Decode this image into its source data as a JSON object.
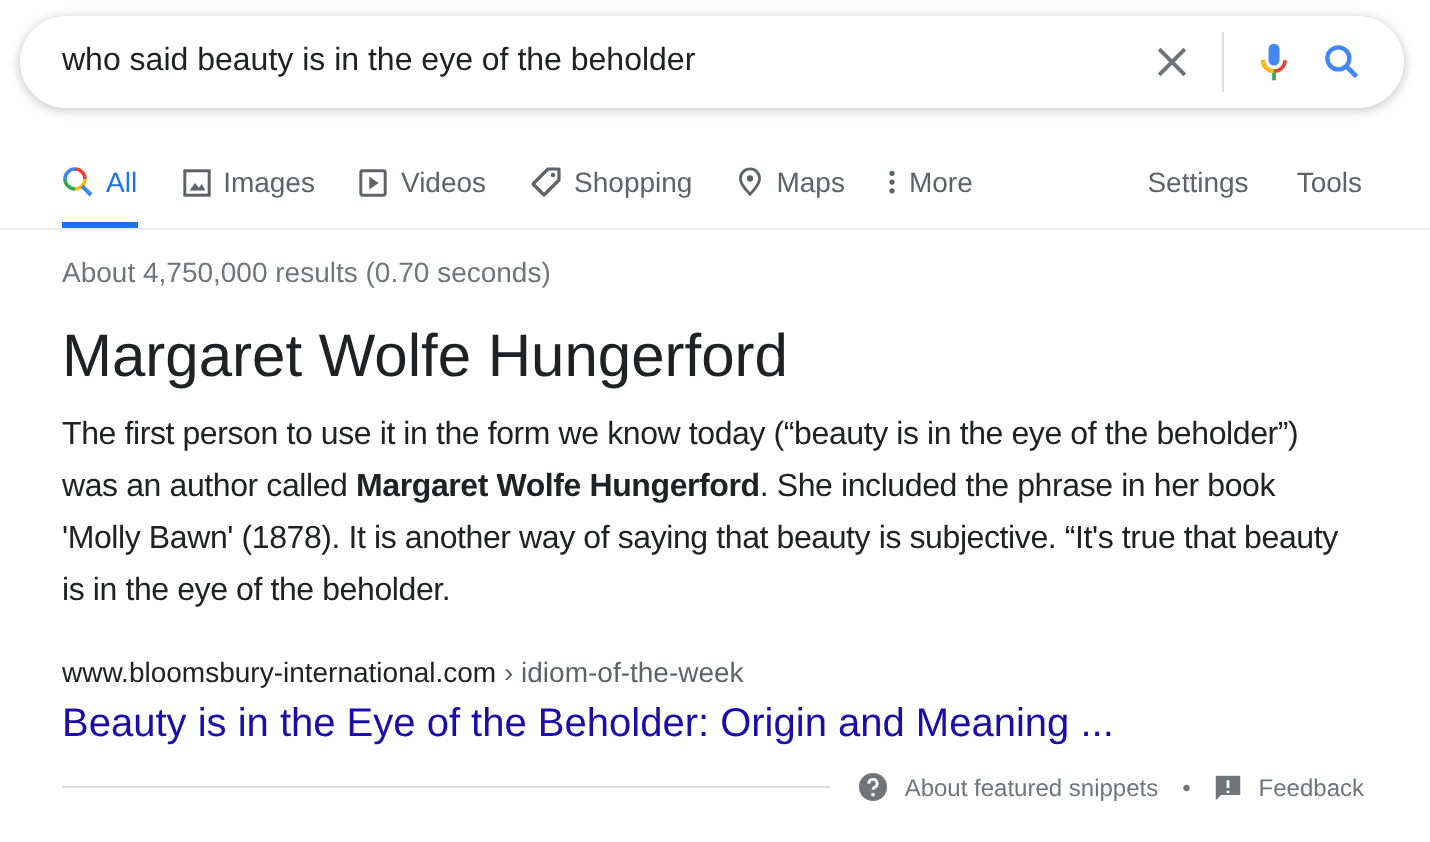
{
  "search": {
    "value": "who said beauty is in the eye of the beholder"
  },
  "tabs": [
    {
      "label": "All",
      "kind": "all",
      "selected": true
    },
    {
      "label": "Images",
      "kind": "images",
      "selected": false
    },
    {
      "label": "Videos",
      "kind": "videos",
      "selected": false
    },
    {
      "label": "Shopping",
      "kind": "shopping",
      "selected": false
    },
    {
      "label": "Maps",
      "kind": "maps",
      "selected": false
    },
    {
      "label": "More",
      "kind": "more",
      "selected": false
    }
  ],
  "tools": [
    "Settings",
    "Tools"
  ],
  "result_stats": "About 4,750,000 results (0.70 seconds)",
  "snippet": {
    "title": "Margaret Wolfe Hungerford",
    "text": "The first person to use it in the form we know today (“beauty is in the eye of the beholder”) was an author called **Margaret Wolfe Hungerford**. She included the phrase in her book 'Molly Bawn' (1878). It is another way of saying that beauty is subjective. “It's true that beauty is in the eye of the beholder.",
    "source_domain": "www.bloomsbury-international.com",
    "source_path": "› idiom-of-the-week",
    "link": "Beauty is in the Eye of the Beholder: Origin and Meaning ...",
    "footer": {
      "about": "About featured snippets",
      "separator": "•",
      "feedback": "Feedback"
    }
  }
}
